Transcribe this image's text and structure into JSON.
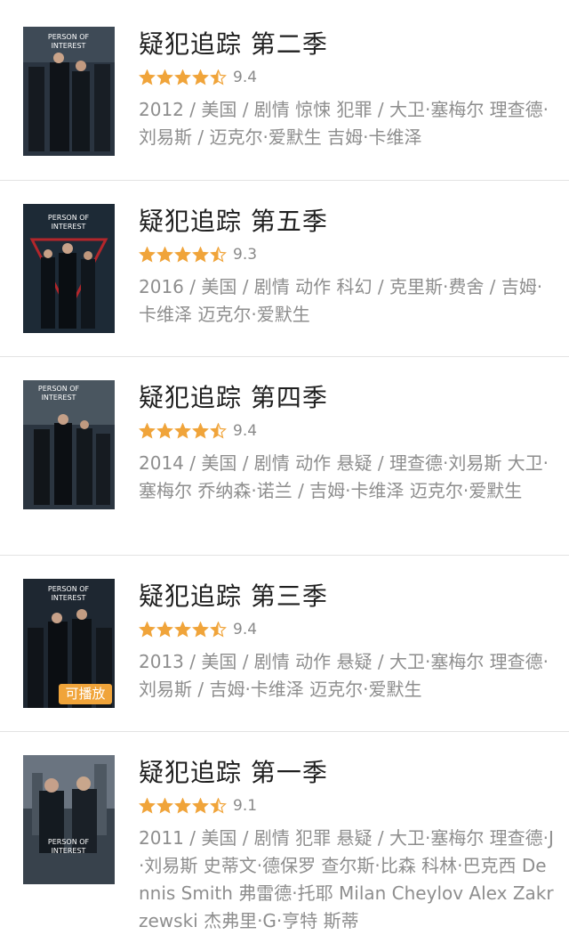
{
  "colors": {
    "star": "#f0a43a",
    "badge": "#f0a43a",
    "title": "#1f1f1f",
    "meta": "#8e8e8e",
    "divider": "#e3e3e3"
  },
  "items": [
    {
      "title": "疑犯追踪 第二季",
      "stars": 4.5,
      "score": "9.4",
      "meta": "2012 / 美国 / 剧情 惊悚 犯罪 / 大卫·塞梅尔 理查德·刘易斯 / 迈克尔·爱默生 吉姆·卡维泽",
      "poster_text": "PERSON OF INTEREST",
      "poster_icon": "poster-image"
    },
    {
      "title": "疑犯追踪 第五季",
      "stars": 4.5,
      "score": "9.3",
      "meta": "2016 / 美国 / 剧情 动作 科幻 / 克里斯·费舍 / 吉姆·卡维泽 迈克尔·爱默生",
      "poster_text": "PERSON OF INTEREST",
      "poster_icon": "poster-image"
    },
    {
      "title": "疑犯追踪 第四季",
      "stars": 4.5,
      "score": "9.4",
      "meta": "2014 / 美国 / 剧情 动作 悬疑 / 理查德·刘易斯 大卫·塞梅尔 乔纳森·诺兰 / 吉姆·卡维泽 迈克尔·爱默生",
      "poster_text": "PERSON OF INTEREST",
      "poster_icon": "poster-image"
    },
    {
      "title": "疑犯追踪 第三季",
      "stars": 4.5,
      "score": "9.4",
      "meta": "2013 / 美国 / 剧情 动作 悬疑 / 大卫·塞梅尔 理查德·刘易斯 / 吉姆·卡维泽 迈克尔·爱默生",
      "poster_text": "PERSON OF INTEREST",
      "poster_icon": "poster-image",
      "badge": "可播放"
    },
    {
      "title": "疑犯追踪 第一季",
      "stars": 4.5,
      "score": "9.1",
      "meta": "2011 / 美国 / 剧情 犯罪 悬疑 / 大卫·塞梅尔 理查德·J·刘易斯 史蒂文·德保罗 查尔斯·比森 科林·巴克西 Dennis Smith 弗雷德·托耶 Milan Cheylov Alex Zakrzewski 杰弗里·G·亨特 斯蒂",
      "poster_text": "PERSON OF INTEREST",
      "poster_icon": "poster-image"
    }
  ]
}
